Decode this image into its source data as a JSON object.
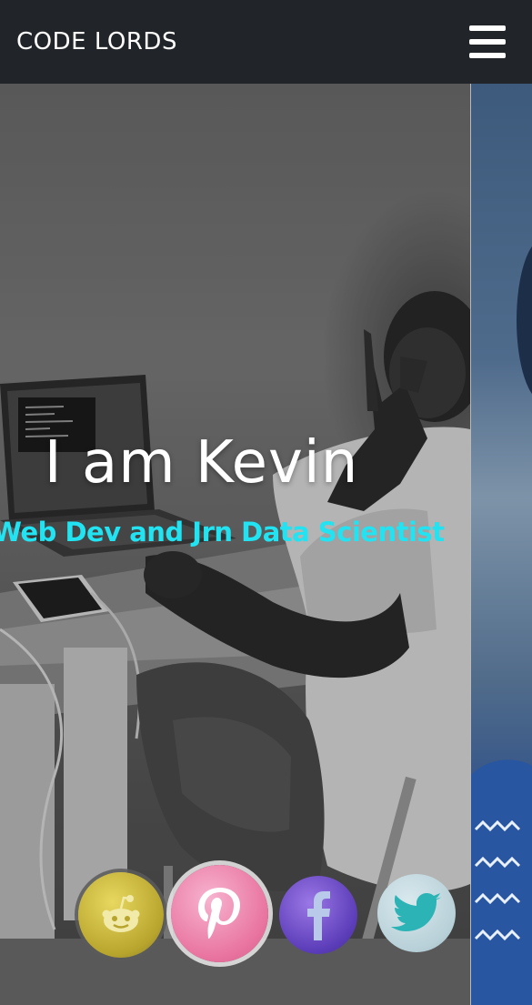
{
  "navbar": {
    "brand": "CODE LORDS",
    "menu_icon": "hamburger-menu-icon"
  },
  "hero": {
    "title": "I am Kevin",
    "subtitle": "Web Dev and Jrn Data Scientist"
  },
  "socials": [
    {
      "icon": "reddit-icon",
      "color": "#d4c14a"
    },
    {
      "icon": "pinterest-icon",
      "color": "#ef8db4"
    },
    {
      "icon": "facebook-icon",
      "color": "#6a48c8"
    },
    {
      "icon": "twitter-icon",
      "color": "#c6dbe1"
    }
  ],
  "colors": {
    "navbar_bg": "#212428",
    "subtitle_accent": "#21e3f1"
  }
}
